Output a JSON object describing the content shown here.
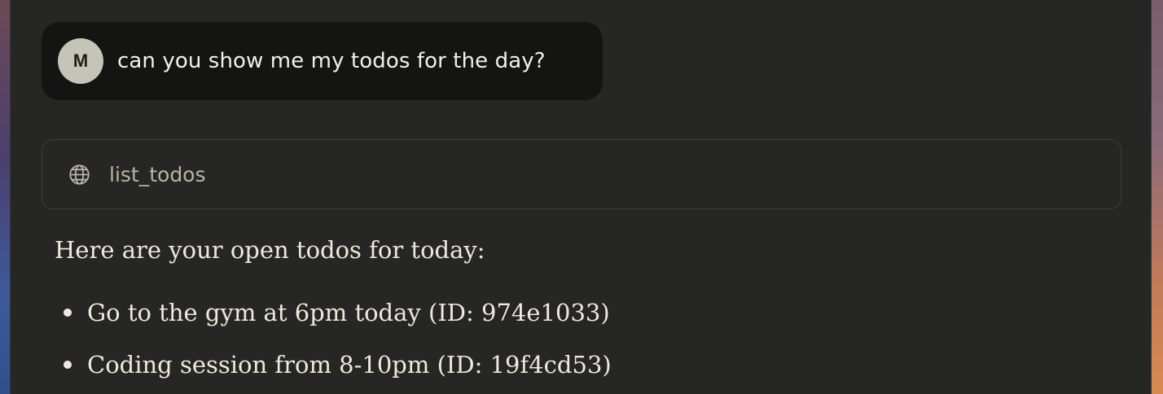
{
  "conversation": {
    "user_message": {
      "avatar_initial": "M",
      "text": "can you show me my todos for the day?"
    },
    "tool_call": {
      "icon": "globe-icon",
      "name": "list_todos"
    },
    "assistant_message": {
      "intro": "Here are your open todos for today:",
      "todos": [
        "Go to the gym at 6pm today (ID: 974e1033)",
        "Coding session from 8-10pm (ID: 19f4cd53)"
      ]
    }
  },
  "colors": {
    "background": "#262624",
    "user_bubble": "#141413",
    "avatar": "#c6c3b9",
    "text_primary": "#ece9e1",
    "text_muted": "#b7b4ab",
    "border": "#3e3d3a"
  }
}
